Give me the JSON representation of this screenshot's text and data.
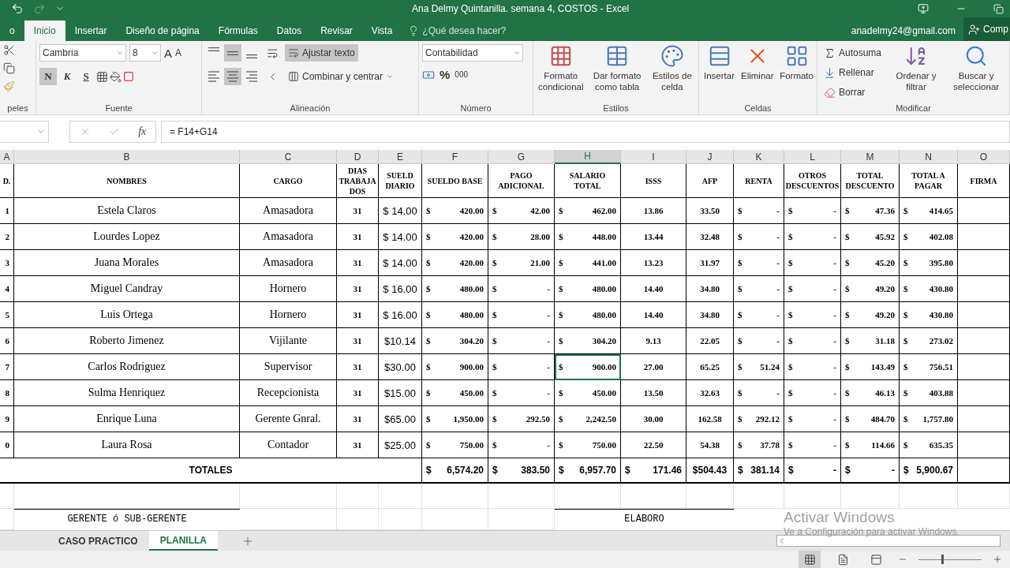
{
  "window": {
    "title": "Ana Delmy Quintanilla. semana 4, COSTOS - Excel"
  },
  "tabs": [
    {
      "label": "o",
      "selected": false
    },
    {
      "label": "Inicio",
      "selected": true
    },
    {
      "label": "Insertar",
      "selected": false
    },
    {
      "label": "Diseño de página",
      "selected": false
    },
    {
      "label": "Fórmulas",
      "selected": false
    },
    {
      "label": "Datos",
      "selected": false
    },
    {
      "label": "Revisar",
      "selected": false
    },
    {
      "label": "Vista",
      "selected": false
    }
  ],
  "tell_me": {
    "placeholder": "¿Qué desea hacer?"
  },
  "account": "anadelmy24@gmail.com",
  "share": "Comp",
  "ribbon": {
    "clipboard": {
      "label": "peles"
    },
    "font": {
      "label": "Fuente",
      "family": "Cambria",
      "size": "8",
      "grow": "A",
      "shrink": "A",
      "styles": [
        {
          "label": "N",
          "on": true
        },
        {
          "label": "K",
          "on": false
        },
        {
          "label": "S",
          "on": false
        }
      ]
    },
    "alignment": {
      "label": "Alineación",
      "vertical": [
        {
          "selected": false
        },
        {
          "selected": true
        },
        {
          "selected": false
        }
      ],
      "horizontal": [
        {
          "selected": false
        },
        {
          "selected": true
        },
        {
          "selected": false
        }
      ],
      "wrap": {
        "label": "Ajustar texto",
        "on": true
      },
      "merge": {
        "label": "Combinar y centrar",
        "on": false
      }
    },
    "number": {
      "label": "Número",
      "format": "Contabilidad",
      "percent": "%",
      "thousands": "000"
    },
    "styles": {
      "label": "Estilos",
      "buttons": [
        {
          "label": "Formato condicional",
          "kind": "conditional"
        },
        {
          "label": "Dar formato como tabla",
          "kind": "table"
        },
        {
          "label": "Estilos de celda",
          "kind": "cellstyle"
        }
      ]
    },
    "cells": {
      "label": "Celdas",
      "buttons": [
        {
          "label": "Insertar",
          "kind": "insert"
        },
        {
          "label": "Eliminar",
          "kind": "delete"
        },
        {
          "label": "Formato",
          "kind": "format"
        }
      ]
    },
    "editing": {
      "label": "Modificar",
      "small": [
        {
          "label": "Autosuma",
          "kind": "sum"
        },
        {
          "label": "Rellenar",
          "kind": "fill"
        },
        {
          "label": "Borrar",
          "kind": "clear"
        }
      ],
      "buttons": [
        {
          "label": "Ordenar y filtrar",
          "kind": "sort"
        },
        {
          "label": "Buscar y seleccionar",
          "kind": "find"
        }
      ]
    }
  },
  "formula_bar": {
    "fx": "fx",
    "formula": "= F14+G14"
  },
  "sheet": {
    "columns": [
      {
        "label": "A",
        "selected": false
      },
      {
        "label": "B",
        "selected": false
      },
      {
        "label": "C",
        "selected": false
      },
      {
        "label": "D",
        "selected": false
      },
      {
        "label": "E",
        "selected": false
      },
      {
        "label": "F",
        "selected": false
      },
      {
        "label": "G",
        "selected": false
      },
      {
        "label": "H",
        "selected": true
      },
      {
        "label": "I",
        "selected": false
      },
      {
        "label": "J",
        "selected": false
      },
      {
        "label": "K",
        "selected": false
      },
      {
        "label": "L",
        "selected": false
      },
      {
        "label": "M",
        "selected": false
      },
      {
        "label": "N",
        "selected": false
      },
      {
        "label": "O",
        "selected": false
      }
    ],
    "headers": [
      "D.",
      "NOMBRES",
      "CARGO",
      "DIAS TRABAJADOS",
      "SUELD DIARIO",
      "SUELDO BASE",
      "PAGO ADICIONAL",
      "SALARIO TOTAL",
      "ISSS",
      "AFP",
      "RENTA",
      "OTROS DESCUENTOS",
      "TOTAL DESCUENTO",
      "TOTAL A PAGAR",
      "FIRMA"
    ],
    "rows": [
      {
        "selected": false,
        "cells": [
          "1",
          "Estela Claros",
          "Amasadora",
          "31",
          "$ 14.00",
          "$ 420.00",
          "$ 42.00",
          "$ 462.00",
          "13.86",
          "33.50",
          "$ -",
          "$ -",
          "$ 47.36",
          "$ 414.65"
        ]
      },
      {
        "selected": false,
        "cells": [
          "2",
          "Lourdes Lopez",
          "Amasadora",
          "31",
          "$ 14.00",
          "$ 420.00",
          "$ 28.00",
          "$ 448.00",
          "13.44",
          "32.48",
          "$ -",
          "$ -",
          "$ 45.92",
          "$ 402.08"
        ]
      },
      {
        "selected": false,
        "cells": [
          "3",
          "Juana Morales",
          "Amasadora",
          "31",
          "$ 14.00",
          "$ 420.00",
          "$ 21.00",
          "$ 441.00",
          "13.23",
          "31.97",
          "$ -",
          "$ -",
          "$ 45.20",
          "$ 395.80"
        ]
      },
      {
        "selected": false,
        "cells": [
          "4",
          "Miguel Candray",
          "Hornero",
          "31",
          "$ 16.00",
          "$ 480.00",
          "$ -",
          "$ 480.00",
          "14.40",
          "34.80",
          "$ -",
          "$ -",
          "$ 49.20",
          "$ 430.80"
        ]
      },
      {
        "selected": false,
        "cells": [
          "5",
          "Luis Ortega",
          "Hornero",
          "31",
          "$ 16.00",
          "$ 480.00",
          "$ -",
          "$ 480.00",
          "14.40",
          "34.80",
          "$ -",
          "$ -",
          "$ 49.20",
          "$ 430.80"
        ]
      },
      {
        "selected": false,
        "cells": [
          "6",
          "Roberto Jimenez",
          "Vijilante",
          "31",
          "$10.14",
          "$ 304.20",
          "$ -",
          "$ 304.20",
          "9.13",
          "22.05",
          "$ -",
          "$ -",
          "$ 31.18",
          "$ 273.02"
        ]
      },
      {
        "selected": true,
        "cells": [
          "7",
          "Carlos Rodriguez",
          "Supervisor",
          "31",
          "$30.00",
          "$ 900.00",
          "$ -",
          "$ 900.00",
          "27.00",
          "65.25",
          "$ 51.24",
          "$ -",
          "$ 143.49",
          "$ 756.51"
        ]
      },
      {
        "selected": false,
        "cells": [
          "8",
          "Sulma Henriquez",
          "Recepcionista",
          "31",
          "$15.00",
          "$ 450.00",
          "$ -",
          "$ 450.00",
          "13.50",
          "32.63",
          "$ -",
          "$ -",
          "$ 46.13",
          "$ 403.88"
        ]
      },
      {
        "selected": false,
        "cells": [
          "9",
          "Enrique Luna",
          "Gerente Gnral.",
          "31",
          "$65.00",
          "$ 1,950.00",
          "$ 292.50",
          "$ 2,242.50",
          "30.00",
          "162.58",
          "$ 292.12",
          "$ -",
          "$ 484.70",
          "$ 1,757.80"
        ]
      },
      {
        "selected": false,
        "cells": [
          "0",
          "Laura Rosa",
          "Contador",
          "31",
          "$25.00",
          "$ 750.00",
          "$ -",
          "$ 750.00",
          "22.50",
          "54.38",
          "$ 37.78",
          "$ -",
          "$ 114.66",
          "$ 635.35"
        ]
      }
    ],
    "totals": {
      "label": "TOTALES",
      "cells": [
        "$ 6,574.20",
        "$ 383.50",
        "$ 6,957.70",
        "$ 171.46",
        "$504.43",
        "$ 381.14",
        "$ -",
        "$ -",
        "$ 5,900.67"
      ]
    },
    "signatures": [
      "GERENTE ó SUB-GERENTE",
      "ELABORO"
    ]
  },
  "sheet_tabs": [
    {
      "label": "CASO PRACTICO",
      "selected": false
    },
    {
      "label": "PLANILLA",
      "selected": true
    }
  ],
  "os_notice": {
    "title": "Activar Windows",
    "text": "Ve a Configuración para activar Windows."
  },
  "status_bar": {
    "views": [
      {
        "kind": "normal",
        "selected": true
      },
      {
        "kind": "layout",
        "selected": false
      },
      {
        "kind": "pagebreak",
        "selected": false
      }
    ],
    "zoom": {
      "level": 0.36
    }
  }
}
